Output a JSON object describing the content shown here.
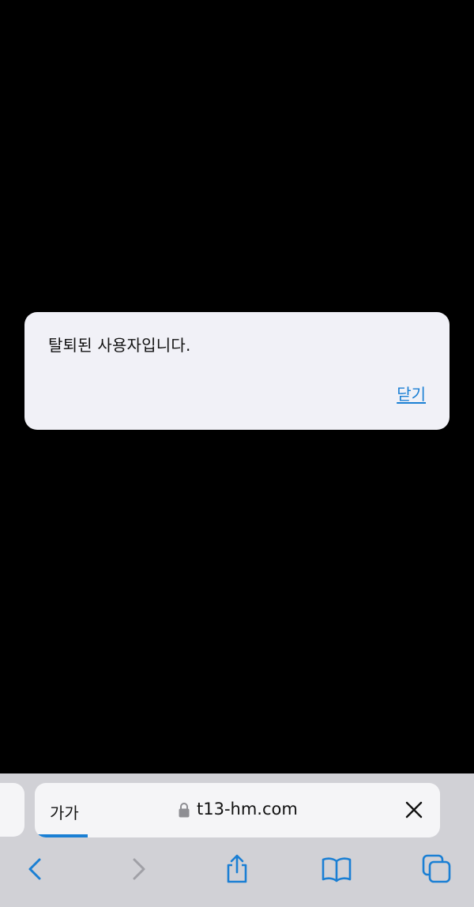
{
  "dialog": {
    "message": "탈퇴된 사용자입니다.",
    "close_label": "닫기"
  },
  "browser": {
    "text_size_label": "가가",
    "url": "t13-hm.com",
    "loading_progress": 0.13
  },
  "toolbar": {
    "icons": [
      "back-icon",
      "forward-icon",
      "share-icon",
      "bookmarks-icon",
      "tabs-icon"
    ]
  },
  "colors": {
    "accent": "#1a7fd4",
    "page_background": "#000000",
    "dialog_background": "#f1f1f7",
    "toolbar_background": "#d1d1d6"
  }
}
